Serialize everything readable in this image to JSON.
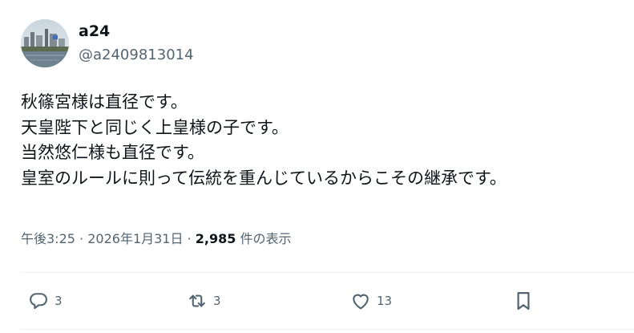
{
  "author": {
    "name": "a24",
    "handle": "@a2409813014"
  },
  "tweet": {
    "lines": [
      "秋篠宮様は直径です。",
      "天皇陛下と同じく上皇様の子です。",
      "当然悠仁様も直径です。",
      "皇室のルールに則って伝統を重んじているからこその継承です。"
    ]
  },
  "meta": {
    "time": "午後3:25",
    "dot": "·",
    "date": "2026年1月31日",
    "views_count": "2,985",
    "views_label": " 件の表示"
  },
  "actions": {
    "reply_count": "3",
    "retweet_count": "3",
    "like_count": "13",
    "reply_icon": "reply-icon",
    "retweet_icon": "retweet-icon",
    "like_icon": "heart-icon",
    "bookmark_icon": "bookmark-icon"
  },
  "colors": {
    "text": "#0f1419",
    "secondary": "#536471",
    "divider": "#eff3f4"
  }
}
